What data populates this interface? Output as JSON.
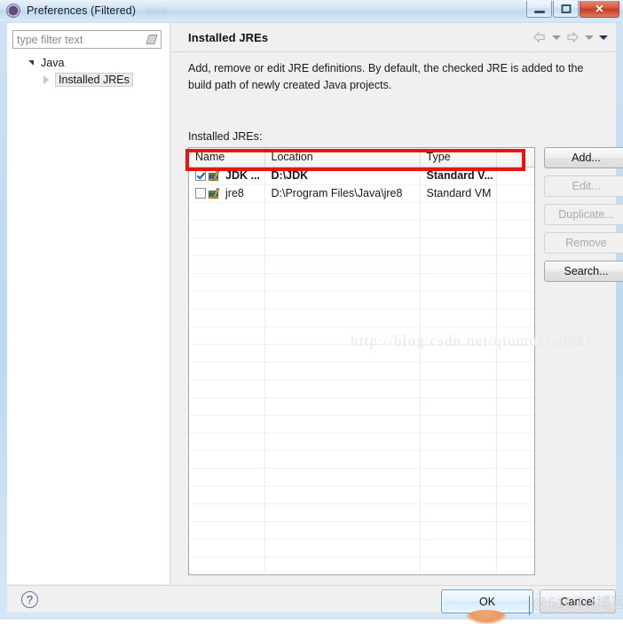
{
  "window": {
    "title": "Preferences (Filtered)",
    "ghost_text": "Java",
    "icon": "gear-icon",
    "controls": {
      "minimize": "minimize-icon",
      "maximize": "maximize-icon",
      "close": "✕"
    }
  },
  "sidebar": {
    "filter": {
      "placeholder": "type filter text",
      "value": "",
      "clear_icon": "eraser-icon"
    },
    "tree": [
      {
        "label": "Java",
        "state": "expanded",
        "level": 0
      },
      {
        "label": "Installed JREs",
        "state": "collapsed",
        "level": 1,
        "selected": true
      }
    ]
  },
  "page": {
    "title": "Installed JREs",
    "description": "Add, remove or edit JRE definitions. By default, the checked JRE is added to the build path of newly created Java projects.",
    "list_label": "Installed JREs:",
    "nav": {
      "back_icon": "arrow-left-icon",
      "back_menu_icon": "chevron-down-icon",
      "forward_icon": "arrow-right-icon",
      "forward_menu_icon": "chevron-down-icon",
      "view_menu_icon": "chevron-down-filled-icon"
    }
  },
  "table": {
    "columns": [
      "Name",
      "Location",
      "Type",
      ""
    ],
    "rows": [
      {
        "checked": true,
        "bold": true,
        "name": "JDK ...",
        "location": "D:\\JDK",
        "type": "Standard V...",
        "extra": ""
      },
      {
        "checked": false,
        "bold": false,
        "name": "jre8",
        "location": "D:\\Program Files\\Java\\jre8",
        "type": "Standard VM",
        "extra": ""
      }
    ],
    "empty_row_count": 22,
    "highlight_color": "#e8160f"
  },
  "buttons": {
    "side": [
      {
        "label": "Add...",
        "enabled": true
      },
      {
        "label": "Edit...",
        "enabled": false
      },
      {
        "label": "Duplicate...",
        "enabled": false
      },
      {
        "label": "Remove",
        "enabled": false
      },
      {
        "label": "Search...",
        "enabled": true
      }
    ]
  },
  "footer": {
    "help_label": "?",
    "ok_label": "OK",
    "cancel_label": "Cancel"
  },
  "watermarks": {
    "csdn": "http://blog.csdn.net/qiumuxia0921",
    "cto": "@51CTO博客"
  },
  "colors": {
    "accent": "#4ea3dd",
    "highlight": "#e8160f",
    "titlebar": "#cde2f4",
    "panel": "#f0f0f0"
  }
}
